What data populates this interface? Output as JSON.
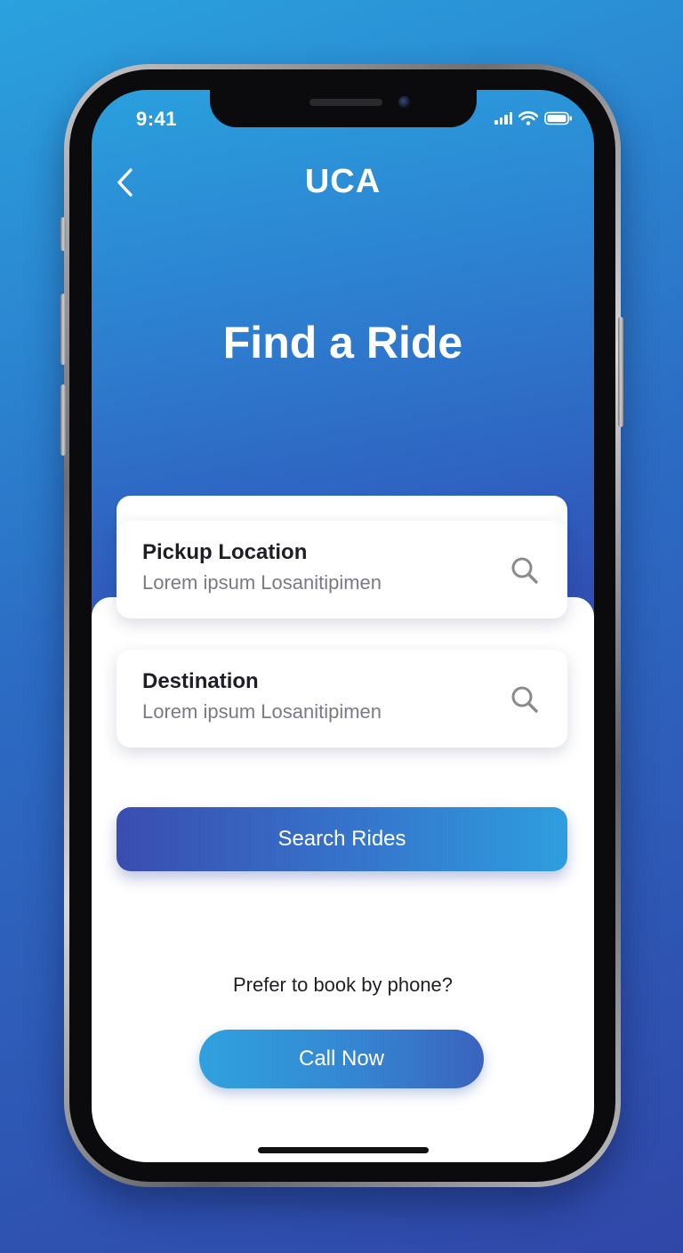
{
  "status_bar": {
    "time": "9:41"
  },
  "header": {
    "app_title": "UCA",
    "back_icon": "chevron-left-icon"
  },
  "page": {
    "title": "Find a Ride"
  },
  "fields": [
    {
      "label": "Pickup Location",
      "value": "Lorem ipsum Losanitipimen",
      "icon": "search-icon"
    },
    {
      "label": "Destination",
      "value": "Lorem ipsum Losanitipimen",
      "icon": "search-icon"
    }
  ],
  "actions": {
    "search_label": "Search Rides",
    "phone_prompt": "Prefer to book by phone?",
    "call_label": "Call Now"
  },
  "colors": {
    "background_top": "#2aa2de",
    "background_bottom": "#3047a8",
    "button_gradient_start": "#3a4db0",
    "button_gradient_end": "#2e9ede",
    "card_background": "#ffffff",
    "label_text": "#1e1f24",
    "value_text": "#7a7b82"
  }
}
